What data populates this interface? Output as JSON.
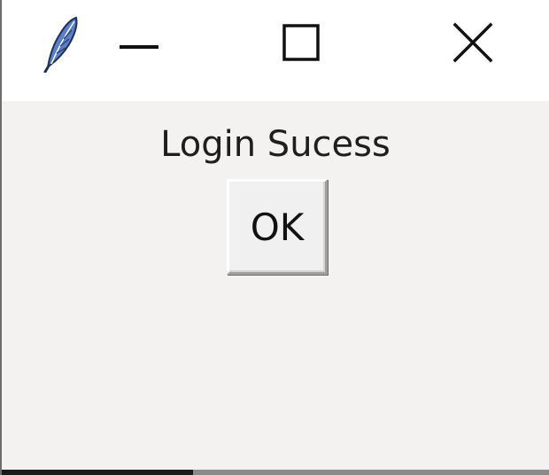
{
  "window": {
    "icon": "feather-icon",
    "controls": {
      "minimize_icon": "minimize-icon",
      "maximize_icon": "maximize-icon",
      "close_icon": "close-icon"
    }
  },
  "dialog": {
    "message": "Login Sucess",
    "ok_label": "OK"
  },
  "colors": {
    "titlebar_background": "#ffffff",
    "client_background": "#f3f2f1",
    "button_face": "#f0f0f0",
    "text": "#1e1e1e",
    "feather_blue": "#5b7fc7"
  }
}
